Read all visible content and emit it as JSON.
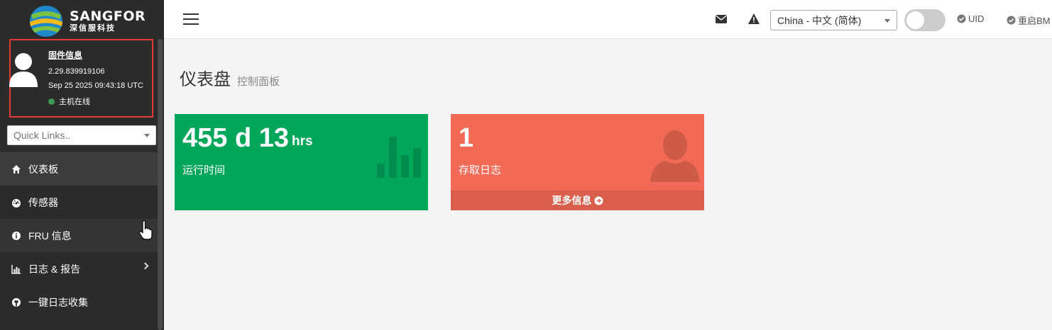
{
  "brand": {
    "name": "SANGFOR",
    "subtitle": "深信服科技"
  },
  "firmware": {
    "title": "固件信息",
    "version": "2.29.839919106",
    "build_date": "Sep 25 2025 09:43:18 UTC",
    "status": "主机在线"
  },
  "quick_links": {
    "placeholder": "Quick Links.."
  },
  "nav": {
    "dashboard": "仪表板",
    "sensors": "传感器",
    "fru": "FRU 信息",
    "logs": "日志 & 报告",
    "collect": "一键日志收集"
  },
  "topbar": {
    "language": "China - 中文 (简体)",
    "uid_label": "UID",
    "reboot_label": "重启BM"
  },
  "page": {
    "title": "仪表盘",
    "subtitle": "控制面板"
  },
  "uptime_box": {
    "value": "455 d 13",
    "unit": "hrs",
    "label": "运行时间",
    "color": "#00a65a"
  },
  "log_box": {
    "value": "1",
    "label": "存取日志",
    "footer": "更多信息",
    "color": "#f26a55"
  }
}
